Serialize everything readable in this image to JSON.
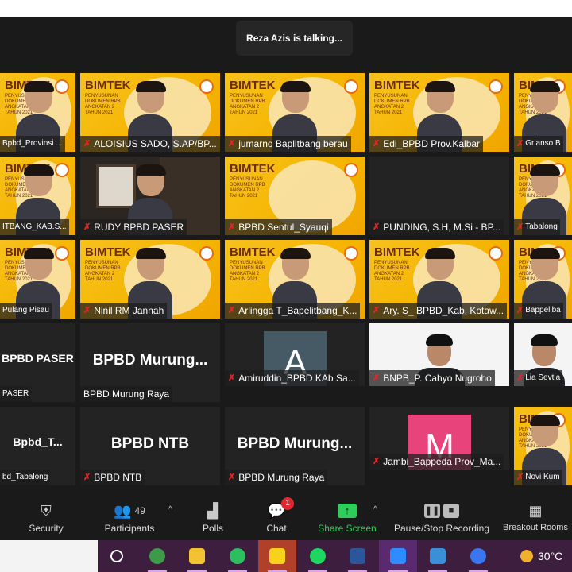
{
  "speaking_banner": "Reza Azis is talking...",
  "tiles": [
    {
      "name": "Bpbd_Provinsi ...",
      "kind": "bimtek"
    },
    {
      "name": "ALOISIUS SADO, S.AP/BP...",
      "kind": "bimtek",
      "muted": true
    },
    {
      "name": "jumarno Baplitbang berau",
      "kind": "bimtek",
      "muted": true
    },
    {
      "name": "Edi_BPBD Prov.Kalbar",
      "kind": "bimtek",
      "muted": true
    },
    {
      "name": "Grianso B",
      "kind": "bimtek",
      "muted": true
    },
    {
      "name": "ITBANG_KAB.S...",
      "kind": "bimtek"
    },
    {
      "name": "RUDY BPBD PASER",
      "kind": "cam",
      "muted": true
    },
    {
      "name": "BPBD Sentul_Syauqi",
      "kind": "bimtek",
      "muted": true,
      "noperson": true
    },
    {
      "name": "PUNDING, S.H, M.Si -  BP...",
      "kind": "blank",
      "muted": true
    },
    {
      "name": "Tabalong",
      "kind": "bimtek",
      "muted": true
    },
    {
      "name": "Pulang Pisau",
      "kind": "bimtek"
    },
    {
      "name": "Ninil RM Jannah",
      "kind": "bimtek",
      "muted": true
    },
    {
      "name": "Arlingga T_Bapelitbang_K...",
      "kind": "bimtek",
      "muted": true
    },
    {
      "name": "Ary. S_ BPBD_Kab. Kotaw...",
      "kind": "bimtek",
      "muted": true
    },
    {
      "name": "Bappeliba",
      "kind": "bimtek",
      "muted": true
    },
    {
      "name": "PASER",
      "kind": "text",
      "big": "BPBD PASER"
    },
    {
      "name": "BPBD Murung Raya",
      "kind": "text",
      "big": "BPBD  Murung..."
    },
    {
      "name": "Amiruddin_BPBD KAb Sa...",
      "kind": "avatar",
      "letter": "A",
      "color": "#465a66",
      "muted": true
    },
    {
      "name": "BNPB_P. Cahyo Nugroho",
      "kind": "photo",
      "muted": true
    },
    {
      "name": "Lia Sevtia",
      "kind": "photo",
      "muted": true
    },
    {
      "name": "bd_Tabalong",
      "kind": "text",
      "big": "Bpbd_T..."
    },
    {
      "name": "BPBD NTB",
      "kind": "text",
      "big": "BPBD NTB",
      "muted": true
    },
    {
      "name": "BPBD Murung Raya",
      "kind": "text",
      "big": "BPBD  Murung...",
      "muted": true
    },
    {
      "name": "Jambi_Bappeda Prov_Ma...",
      "kind": "avatar",
      "letter": "M",
      "color": "#e8437a",
      "muted": true
    },
    {
      "name": "Novi Kum",
      "kind": "bimtek",
      "muted": true
    }
  ],
  "bimtek": {
    "title": "BIMTEK",
    "subtitle": "PENYUSUNAN DOKUMEN RPB ANGKATAN 2 TAHUN 2021"
  },
  "toolbar": {
    "security": "Security",
    "participants": "Participants",
    "participants_count": "49",
    "polls": "Polls",
    "chat": "Chat",
    "chat_badge": "1",
    "share": "Share Screen",
    "recording": "Pause/Stop Recording",
    "breakout": "Breakout Rooms",
    "share_color": "#2ecc5a"
  },
  "taskbar": {
    "temperature": "30°C",
    "apps": [
      "cortana",
      "chrome",
      "file-explorer",
      "evernote",
      "sticky-notes",
      "spotify",
      "word",
      "zoom",
      "photos",
      "signal"
    ]
  }
}
